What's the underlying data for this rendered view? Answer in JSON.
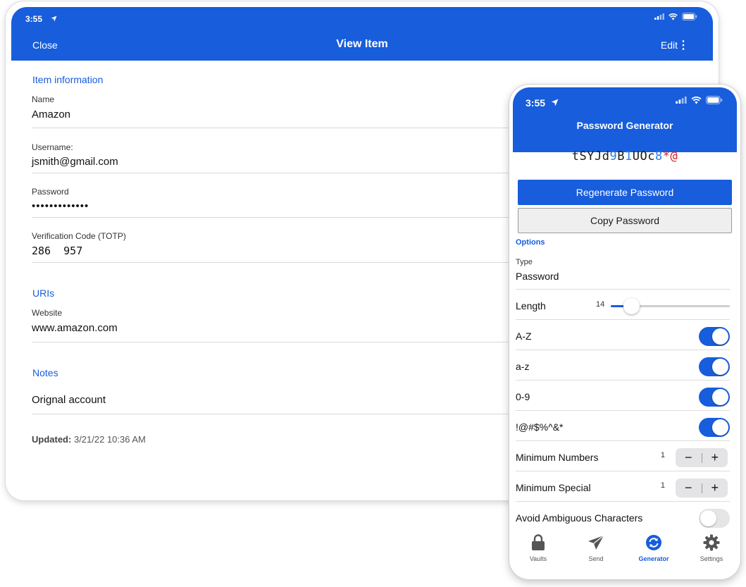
{
  "tablet": {
    "status": {
      "time": "3:55"
    },
    "header": {
      "close": "Close",
      "title": "View Item",
      "edit": "Edit",
      "menu_glyph": "⋮"
    },
    "sections": {
      "item_information": "Item information",
      "uris": "URIs",
      "notes": "Notes"
    },
    "fields": {
      "name_label": "Name",
      "name_value": "Amazon",
      "username_label": "Username:",
      "username_value": "jsmith@gmail.com",
      "password_label": "Password",
      "password_value": "•••••••••••••",
      "totp_label": "Verification Code (TOTP)",
      "totp_value": "286  957",
      "website_label": "Website",
      "website_value": "www.amazon.com",
      "notes_value": "Orignal account"
    },
    "updated": {
      "label": "Updated:",
      "value": "3/21/22 10:36 AM"
    }
  },
  "phone": {
    "status": {
      "time": "3:55"
    },
    "title": "Password Generator",
    "generated_password": [
      {
        "t": "tSYJd",
        "k": "letter"
      },
      {
        "t": "9",
        "k": "number"
      },
      {
        "t": "B",
        "k": "letter"
      },
      {
        "t": "1",
        "k": "number"
      },
      {
        "t": "UOc",
        "k": "letter"
      },
      {
        "t": "8",
        "k": "number"
      },
      {
        "t": "*@",
        "k": "special"
      }
    ],
    "regenerate_button": "Regenerate Password",
    "copy_button": "Copy Password",
    "options_header": "Options",
    "type_label": "Type",
    "type_value": "Password",
    "length": {
      "label": "Length",
      "value": "14",
      "fill_fraction": 0.13
    },
    "toggles": {
      "uppercase": {
        "label": "A-Z",
        "on": true
      },
      "lowercase": {
        "label": "a-z",
        "on": true
      },
      "numbers": {
        "label": "0-9",
        "on": true
      },
      "special": {
        "label": "!@#$%^&*",
        "on": true
      },
      "avoid_ambiguous": {
        "label": "Avoid Ambiguous Characters",
        "on": false
      }
    },
    "min_numbers": {
      "label": "Minimum Numbers",
      "value": "1"
    },
    "min_special": {
      "label": "Minimum Special",
      "value": "1"
    },
    "stepper": {
      "minus": "−",
      "plus": "+"
    },
    "tabs": [
      {
        "label": "Vaults",
        "icon": "lock-icon",
        "active": false
      },
      {
        "label": "Send",
        "icon": "send-icon",
        "active": false
      },
      {
        "label": "Generator",
        "icon": "generator-icon",
        "active": true
      },
      {
        "label": "Settings",
        "icon": "gear-icon",
        "active": false
      }
    ]
  },
  "colors": {
    "brand_blue": "#175ddc",
    "password_number": "#2f7de1",
    "password_special": "#cf2027"
  }
}
